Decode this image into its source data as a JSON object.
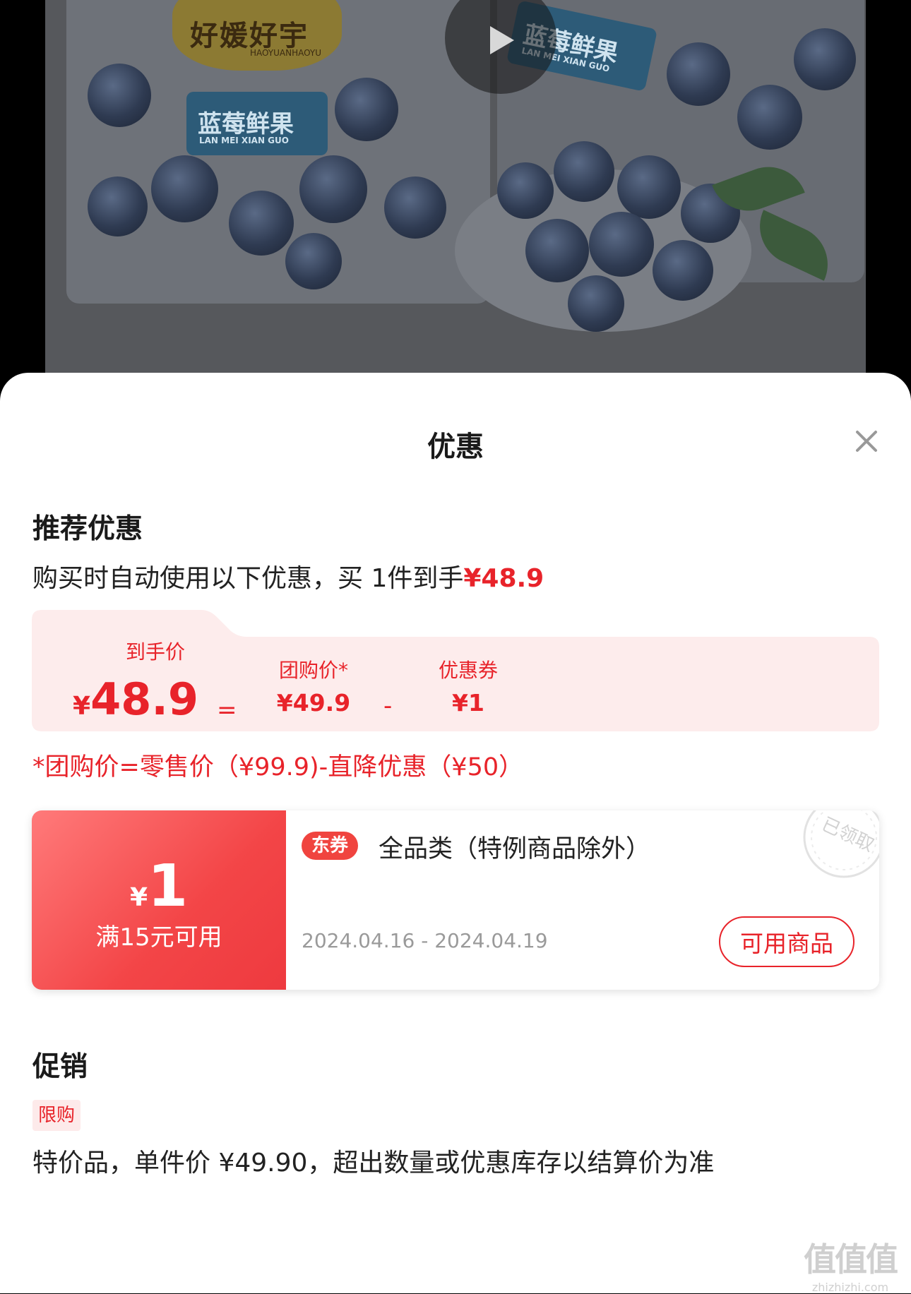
{
  "product_media": {
    "brand_text": "好媛好宇",
    "brand_sub": "HAOYUANHAOYU",
    "tag_title": "蓝莓鲜果",
    "tag_sub": "LAN MEI XIAN GUO",
    "play_icon": "play-icon"
  },
  "sheet": {
    "title": "优惠",
    "close_icon": "close-icon"
  },
  "recommended": {
    "title": "推荐优惠",
    "summary_text": "购买时自动使用以下优惠，买 1件到手",
    "summary_price": "¥48.9",
    "breakdown": {
      "final_label": "到手价",
      "final_currency": "¥",
      "final_value": "48.9",
      "equals": "=",
      "group_label": "团购价*",
      "group_value": "¥49.9",
      "minus": "-",
      "coupon_label": "优惠券",
      "coupon_value": "¥1"
    },
    "footnote": "*团购价=零售价（¥99.9)-直降优惠（¥50）"
  },
  "coupon": {
    "currency": "¥",
    "amount": "1",
    "condition": "满15元可用",
    "badge": "东券",
    "description": "全品类（特例商品除外）",
    "dates": "2024.04.16 - 2024.04.19",
    "button": "可用商品",
    "stamp_text": "已领取"
  },
  "promotion": {
    "title": "促销",
    "badge": "限购",
    "description": "特价品，单件价 ¥49.90，超出数量或优惠库存以结算价为准"
  },
  "watermark": {
    "big": "值值值",
    "small": "zhizhizhi.com"
  },
  "colors": {
    "accent": "#e8232a",
    "card_bg": "#fdecec",
    "coupon_gradient_start": "#ff7a7a",
    "coupon_gradient_end": "#ee3a3f"
  }
}
